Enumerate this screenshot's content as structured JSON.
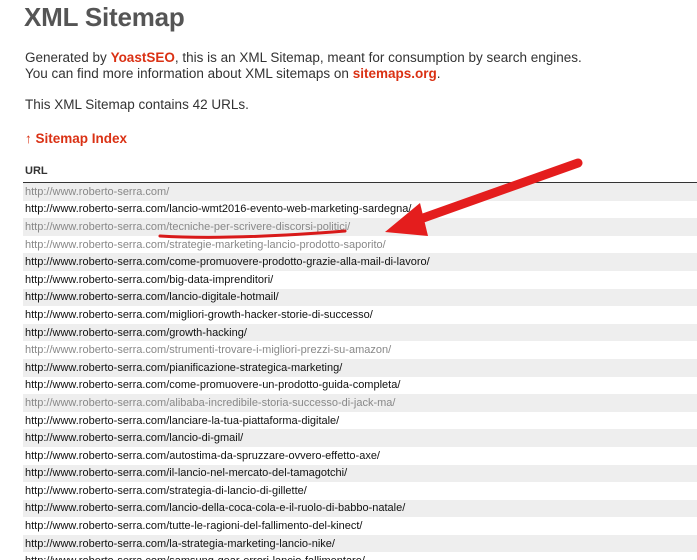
{
  "header": {
    "title": "XML Sitemap"
  },
  "intro": {
    "line1_prefix": "Generated by ",
    "generator_link": "YoastSEO",
    "line1_suffix": ", this is an XML Sitemap, meant for consumption by search engines.",
    "line2_prefix": "You can find more information about XML sitemaps on ",
    "sitemaps_link": "sitemaps.org",
    "line2_suffix": "."
  },
  "count_text": "This XML Sitemap contains 42 URLs.",
  "index_link": {
    "arrow": "↑",
    "label": "Sitemap Index"
  },
  "table": {
    "header": "URL",
    "rows": [
      {
        "url": "http://www.roberto-serra.com/",
        "visited": true
      },
      {
        "url": "http://www.roberto-serra.com/lancio-wmt2016-evento-web-marketing-sardegna/",
        "visited": false
      },
      {
        "url": "http://www.roberto-serra.com/tecniche-per-scrivere-discorsi-politici/",
        "visited": true
      },
      {
        "url": "http://www.roberto-serra.com/strategie-marketing-lancio-prodotto-saporito/",
        "visited": true
      },
      {
        "url": "http://www.roberto-serra.com/come-promuovere-prodotto-grazie-alla-mail-di-lavoro/",
        "visited": false
      },
      {
        "url": "http://www.roberto-serra.com/big-data-imprenditori/",
        "visited": false
      },
      {
        "url": "http://www.roberto-serra.com/lancio-digitale-hotmail/",
        "visited": false
      },
      {
        "url": "http://www.roberto-serra.com/migliori-growth-hacker-storie-di-successo/",
        "visited": false
      },
      {
        "url": "http://www.roberto-serra.com/growth-hacking/",
        "visited": false
      },
      {
        "url": "http://www.roberto-serra.com/strumenti-trovare-i-migliori-prezzi-su-amazon/",
        "visited": true
      },
      {
        "url": "http://www.roberto-serra.com/pianificazione-strategica-marketing/",
        "visited": false
      },
      {
        "url": "http://www.roberto-serra.com/come-promuovere-un-prodotto-guida-completa/",
        "visited": false
      },
      {
        "url": "http://www.roberto-serra.com/alibaba-incredibile-storia-successo-di-jack-ma/",
        "visited": true
      },
      {
        "url": "http://www.roberto-serra.com/lanciare-la-tua-piattaforma-digitale/",
        "visited": false
      },
      {
        "url": "http://www.roberto-serra.com/lancio-di-gmail/",
        "visited": false
      },
      {
        "url": "http://www.roberto-serra.com/autostima-da-spruzzare-ovvero-effetto-axe/",
        "visited": false
      },
      {
        "url": "http://www.roberto-serra.com/il-lancio-nel-mercato-del-tamagotchi/",
        "visited": false
      },
      {
        "url": "http://www.roberto-serra.com/strategia-di-lancio-di-gillette/",
        "visited": false
      },
      {
        "url": "http://www.roberto-serra.com/lancio-della-coca-cola-e-il-ruolo-di-babbo-natale/",
        "visited": false
      },
      {
        "url": "http://www.roberto-serra.com/tutte-le-ragioni-del-fallimento-del-kinect/",
        "visited": false
      },
      {
        "url": "http://www.roberto-serra.com/la-strategia-marketing-lancio-nike/",
        "visited": false
      },
      {
        "url": "http://www.roberto-serra.com/samsung-gear-errori-lancio-fallimentare/",
        "visited": false
      }
    ]
  },
  "annotation": {
    "arrow_color": "#e41d1d",
    "underline_color": "#d81a1a",
    "highlighted_row": 2
  },
  "colors": {
    "title": "#555555",
    "link_accent": "#da3114",
    "row_alt_bg": "#eeeeee",
    "visited_link": "#888888"
  }
}
